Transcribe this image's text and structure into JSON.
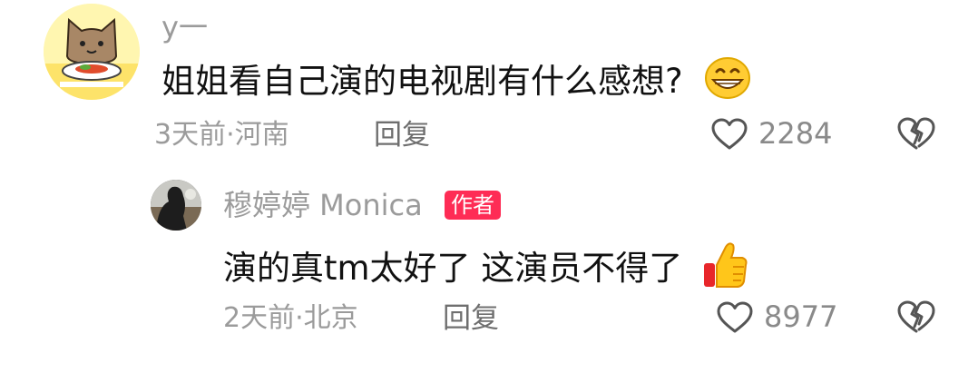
{
  "comment": {
    "username": "y一",
    "text": "姐姐看自己演的电视剧有什么感想?",
    "emoji_icon": "grinning-face-icon",
    "meta": "3天前·河南",
    "reply_label": "回复",
    "like_count": "2284"
  },
  "reply": {
    "username": "穆婷婷 Monica",
    "author_badge": "作者",
    "text": "演的真tm太好了 这演员不得了",
    "emoji_icon": "thumbs-up-icon",
    "meta": "2天前·北京",
    "reply_label": "回复",
    "like_count": "8977"
  },
  "icons": {
    "like": "heart-outline-icon",
    "dislike": "broken-heart-icon"
  },
  "colors": {
    "badge": "#fe2c55",
    "secondary_text": "#9b9b9b"
  }
}
